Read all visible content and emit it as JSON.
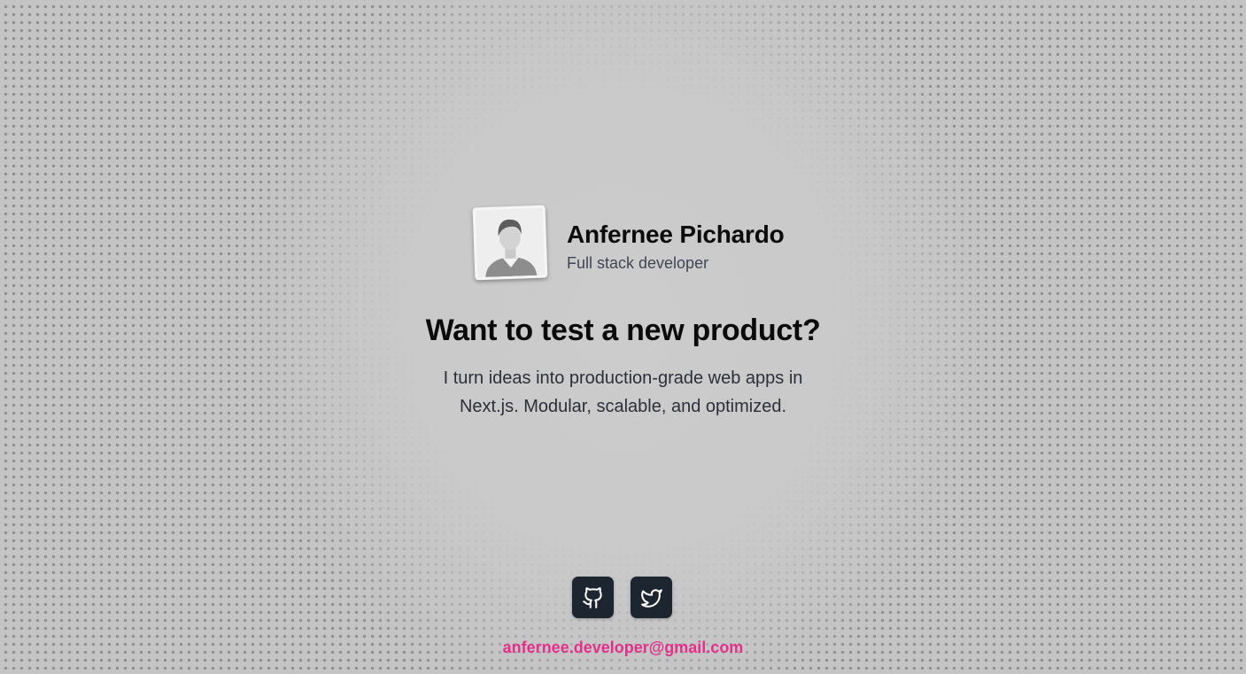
{
  "profile": {
    "name": "Anfernee Pichardo",
    "role": "Full stack developer",
    "avatar_icon": "user-avatar-icon"
  },
  "hero": {
    "headline": "Want to test a new product?",
    "pitch": "I turn ideas into production-grade web apps in Next.js. Modular, scalable, and optimized."
  },
  "socials": [
    {
      "icon": "github-icon"
    },
    {
      "icon": "twitter-icon"
    }
  ],
  "contact": {
    "email": "anfernee.developer@gmail.com"
  },
  "colors": {
    "background": "#c6c6c6",
    "text": "#0b0b0b",
    "muted": "#3f4656",
    "button": "#1d2531",
    "accent": "#e4308d"
  }
}
